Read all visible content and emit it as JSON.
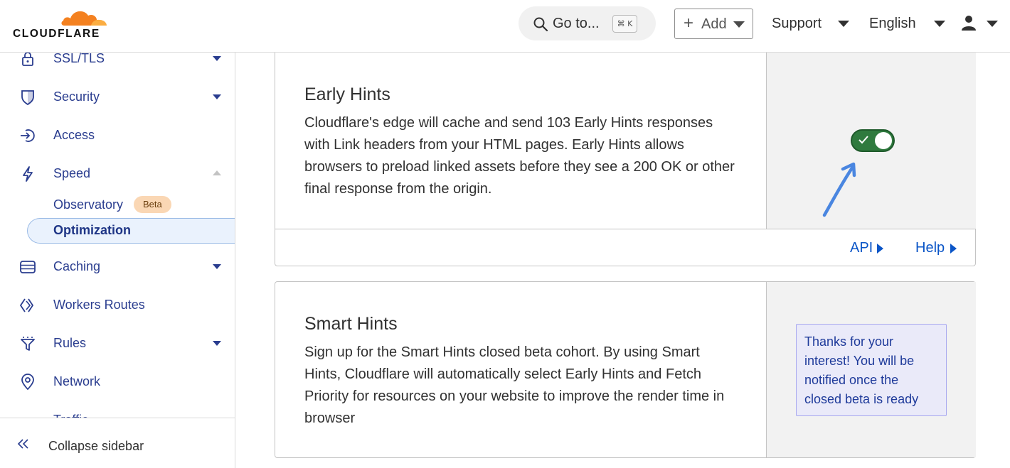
{
  "brand": {
    "name": "CLOUDFLARE",
    "cloud_color": "#f48120"
  },
  "topbar": {
    "search": {
      "label": "Go to...",
      "shortcut": "⌘ K",
      "icon": "search-icon"
    },
    "add_label": "Add",
    "support_label": "Support",
    "language_label": "English",
    "user_icon": "user-icon"
  },
  "sidebar": {
    "items": [
      {
        "label": "SSL/TLS",
        "icon": "lock-icon",
        "expandable": true
      },
      {
        "label": "Security",
        "icon": "shield-icon",
        "expandable": true
      },
      {
        "label": "Access",
        "icon": "access-icon",
        "expandable": false
      },
      {
        "label": "Speed",
        "icon": "lightning-icon",
        "expanded": true
      },
      {
        "label": "Caching",
        "icon": "caching-icon",
        "expandable": true
      },
      {
        "label": "Workers Routes",
        "icon": "workers-icon",
        "expandable": false
      },
      {
        "label": "Rules",
        "icon": "rules-icon",
        "expandable": true
      },
      {
        "label": "Network",
        "icon": "location-pin-icon",
        "expandable": false
      },
      {
        "label": "Traffic",
        "icon": "traffic-icon",
        "expandable": true
      }
    ],
    "speed_children": [
      {
        "label": "Observatory",
        "badge": "Beta",
        "active": false
      },
      {
        "label": "Optimization",
        "active": true
      }
    ],
    "collapse_label": "Collapse sidebar"
  },
  "cards": {
    "early_hints": {
      "title": "Early Hints",
      "description": "Cloudflare's edge will cache and send 103 Early Hints responses with Link headers from your HTML pages. Early Hints allows browsers to preload linked assets before they see a 200 OK or other final response from the origin.",
      "enabled": true,
      "api_label": "API",
      "help_label": "Help"
    },
    "smart_hints": {
      "title": "Smart Hints",
      "description": "Sign up for the Smart Hints closed beta cohort. By using Smart Hints, Cloudflare will automatically select Early Hints and Fetch Priority for resources on your website to improve the render time in browser",
      "notice": "Thanks for your interest! You will be notified once the closed beta is ready"
    }
  },
  "colors": {
    "nav_text": "#2a3d8f",
    "toggle_on": "#2f7a3e",
    "link": "#0a55c7",
    "annotation_arrow": "#4a86e0",
    "notice_bg": "#eaeaf9"
  }
}
